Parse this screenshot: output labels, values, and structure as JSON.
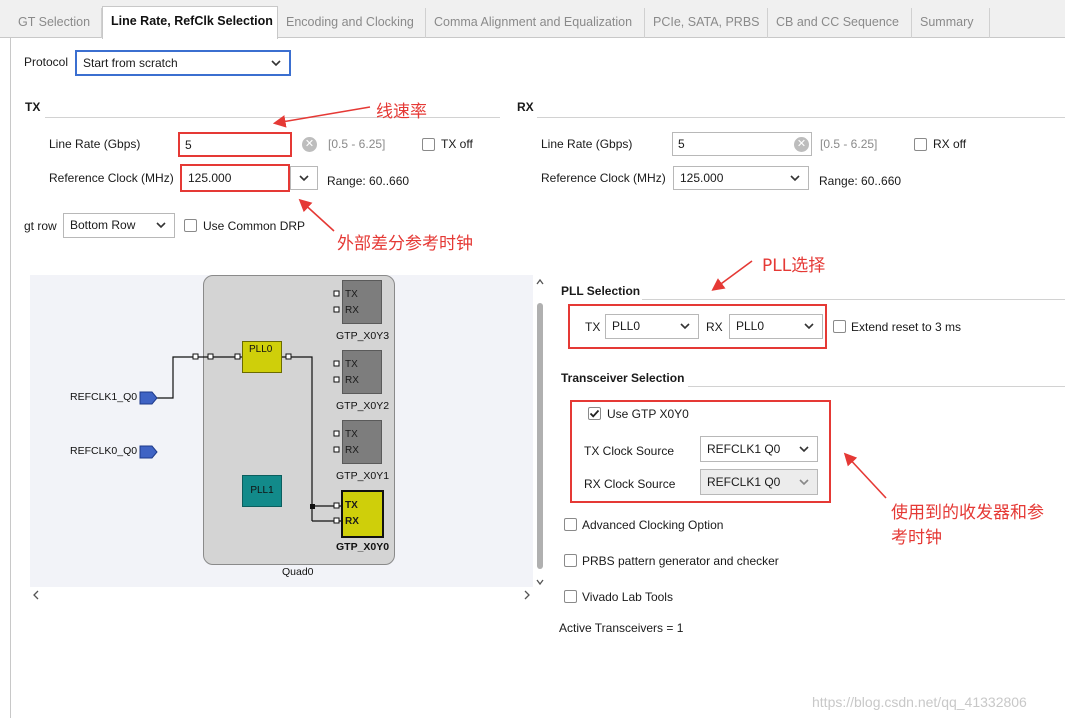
{
  "tabs": [
    {
      "label": "GT Selection"
    },
    {
      "label": "Line Rate, RefClk Selection"
    },
    {
      "label": "Encoding and Clocking"
    },
    {
      "label": "Comma Alignment and Equalization"
    },
    {
      "label": "PCIe, SATA, PRBS"
    },
    {
      "label": "CB and CC Sequence"
    },
    {
      "label": "Summary"
    }
  ],
  "protocol": {
    "label": "Protocol",
    "value": "Start from scratch"
  },
  "tx": {
    "title": "TX",
    "line_rate_label": "Line Rate (Gbps)",
    "line_rate_value": "5",
    "line_rate_range": "[0.5 - 6.25]",
    "off_label": "TX off",
    "refclk_label": "Reference Clock (MHz)",
    "refclk_value": "125.000",
    "refclk_range": "Range: 60..660"
  },
  "rx": {
    "title": "RX",
    "line_rate_label": "Line Rate (Gbps)",
    "line_rate_value": "5",
    "line_rate_range": "[0.5 - 6.25]",
    "off_label": "RX off",
    "refclk_label": "Reference Clock (MHz)",
    "refclk_value": "125.000",
    "refclk_range": "Range: 60..660"
  },
  "gt_row": {
    "label": "gt row",
    "value": "Bottom Row",
    "common_drp_label": "Use Common DRP"
  },
  "diagram": {
    "refclk1": "REFCLK1_Q0",
    "refclk0": "REFCLK0_Q0",
    "pll0": "PLL0",
    "pll1": "PLL1",
    "quad": "Quad0",
    "tx_port": "TX",
    "rx_port": "RX",
    "gtp_labels": [
      "GTP_X0Y3",
      "GTP_X0Y2",
      "GTP_X0Y1",
      "GTP_X0Y0"
    ]
  },
  "pll_selection": {
    "title": "PLL Selection",
    "tx_label": "TX",
    "tx_value": "PLL0",
    "rx_label": "RX",
    "rx_value": "PLL0",
    "extend_reset_label": "Extend reset to 3 ms"
  },
  "transceiver_selection": {
    "title": "Transceiver Selection",
    "use_gtp_label": "Use GTP X0Y0",
    "use_gtp_checked": true,
    "tx_clock_source_label": "TX Clock Source",
    "tx_clock_source_value": "REFCLK1 Q0",
    "rx_clock_source_label": "RX Clock Source",
    "rx_clock_source_value": "REFCLK1 Q0"
  },
  "options": {
    "advanced_clocking": "Advanced Clocking Option",
    "prbs": "PRBS pattern generator and checker",
    "vivado_lab": "Vivado Lab Tools"
  },
  "active_transceivers": "Active Transceivers = 1",
  "annotations": {
    "line_rate": "线速率",
    "ref_clock": "外部差分参考时钟",
    "pll_select": "PLL选择",
    "transceiver_line1": "使用到的收发器和参",
    "transceiver_line2": "考时钟"
  },
  "watermark": "https://blog.csdn.net/qq_41332806",
  "colors": {
    "annotation_red": "#e53935",
    "pll0_yellow": "#cfcf0a",
    "pll1_teal": "#128a8a",
    "refclk_blue": "#3f63c4",
    "protocol_border": "#3b6fd0"
  }
}
